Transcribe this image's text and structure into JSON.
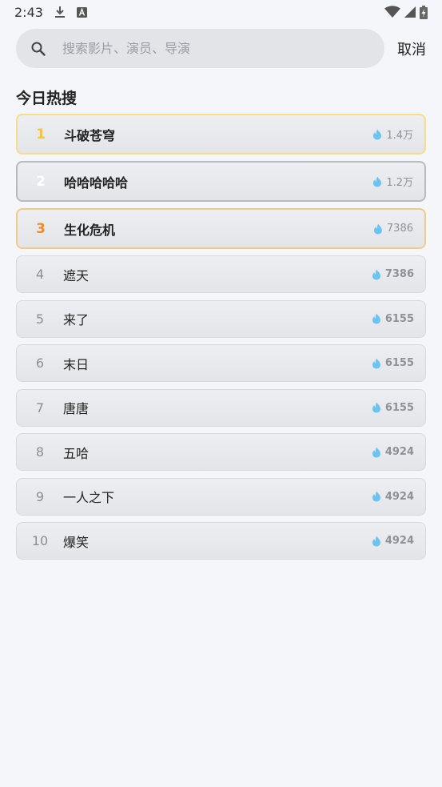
{
  "status": {
    "time": "2:43"
  },
  "search": {
    "placeholder": "搜索影片、演员、导演",
    "value": "",
    "cancel_label": "取消"
  },
  "section": {
    "title": "今日热搜"
  },
  "colors": {
    "gold": "#f6c532",
    "silver": "#ffffff",
    "bronze": "#f08b26",
    "flame": "#6cc3f0"
  },
  "hot_list": [
    {
      "rank": "1",
      "title": "斗破苍穹",
      "heat": "1.4万"
    },
    {
      "rank": "2",
      "title": "哈哈哈哈哈",
      "heat": "1.2万"
    },
    {
      "rank": "3",
      "title": "生化危机",
      "heat": "7386"
    },
    {
      "rank": "4",
      "title": "遮天",
      "heat": "7386"
    },
    {
      "rank": "5",
      "title": "来了",
      "heat": "6155"
    },
    {
      "rank": "6",
      "title": "末日",
      "heat": "6155"
    },
    {
      "rank": "7",
      "title": "唐唐",
      "heat": "6155"
    },
    {
      "rank": "8",
      "title": "五哈",
      "heat": "4924"
    },
    {
      "rank": "9",
      "title": "一人之下",
      "heat": "4924"
    },
    {
      "rank": "10",
      "title": "爆笑",
      "heat": "4924"
    }
  ]
}
